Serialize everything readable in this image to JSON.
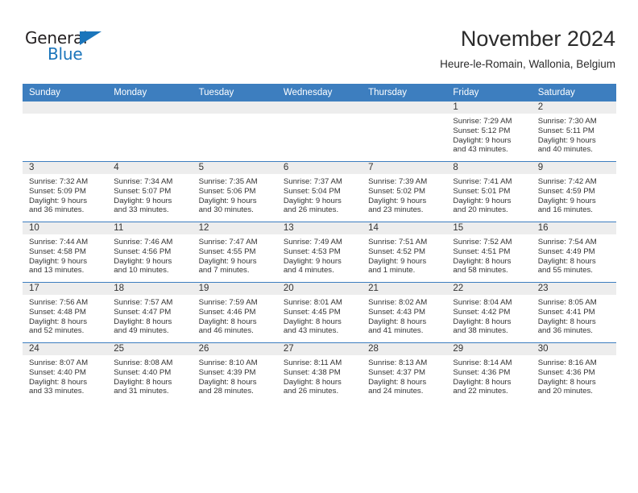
{
  "brand": {
    "name_part1": "General",
    "name_part2": "Blue",
    "accent_color": "#1b75bb",
    "logo_icon": "triangle-icon"
  },
  "header": {
    "title": "November 2024",
    "subtitle": "Heure-le-Romain, Wallonia, Belgium"
  },
  "theme": {
    "header_blue": "#3d7ebf",
    "daynum_gray": "#ededed"
  },
  "weekdays": [
    "Sunday",
    "Monday",
    "Tuesday",
    "Wednesday",
    "Thursday",
    "Friday",
    "Saturday"
  ],
  "weeks": [
    [
      {
        "day": "",
        "empty": true,
        "sunrise": "",
        "sunset": "",
        "daylight1": "",
        "daylight2": ""
      },
      {
        "day": "",
        "empty": true,
        "sunrise": "",
        "sunset": "",
        "daylight1": "",
        "daylight2": ""
      },
      {
        "day": "",
        "empty": true,
        "sunrise": "",
        "sunset": "",
        "daylight1": "",
        "daylight2": ""
      },
      {
        "day": "",
        "empty": true,
        "sunrise": "",
        "sunset": "",
        "daylight1": "",
        "daylight2": ""
      },
      {
        "day": "",
        "empty": true,
        "sunrise": "",
        "sunset": "",
        "daylight1": "",
        "daylight2": ""
      },
      {
        "day": "1",
        "sunrise": "Sunrise: 7:29 AM",
        "sunset": "Sunset: 5:12 PM",
        "daylight1": "Daylight: 9 hours",
        "daylight2": "and 43 minutes."
      },
      {
        "day": "2",
        "sunrise": "Sunrise: 7:30 AM",
        "sunset": "Sunset: 5:11 PM",
        "daylight1": "Daylight: 9 hours",
        "daylight2": "and 40 minutes."
      }
    ],
    [
      {
        "day": "3",
        "sunrise": "Sunrise: 7:32 AM",
        "sunset": "Sunset: 5:09 PM",
        "daylight1": "Daylight: 9 hours",
        "daylight2": "and 36 minutes."
      },
      {
        "day": "4",
        "sunrise": "Sunrise: 7:34 AM",
        "sunset": "Sunset: 5:07 PM",
        "daylight1": "Daylight: 9 hours",
        "daylight2": "and 33 minutes."
      },
      {
        "day": "5",
        "sunrise": "Sunrise: 7:35 AM",
        "sunset": "Sunset: 5:06 PM",
        "daylight1": "Daylight: 9 hours",
        "daylight2": "and 30 minutes."
      },
      {
        "day": "6",
        "sunrise": "Sunrise: 7:37 AM",
        "sunset": "Sunset: 5:04 PM",
        "daylight1": "Daylight: 9 hours",
        "daylight2": "and 26 minutes."
      },
      {
        "day": "7",
        "sunrise": "Sunrise: 7:39 AM",
        "sunset": "Sunset: 5:02 PM",
        "daylight1": "Daylight: 9 hours",
        "daylight2": "and 23 minutes."
      },
      {
        "day": "8",
        "sunrise": "Sunrise: 7:41 AM",
        "sunset": "Sunset: 5:01 PM",
        "daylight1": "Daylight: 9 hours",
        "daylight2": "and 20 minutes."
      },
      {
        "day": "9",
        "sunrise": "Sunrise: 7:42 AM",
        "sunset": "Sunset: 4:59 PM",
        "daylight1": "Daylight: 9 hours",
        "daylight2": "and 16 minutes."
      }
    ],
    [
      {
        "day": "10",
        "sunrise": "Sunrise: 7:44 AM",
        "sunset": "Sunset: 4:58 PM",
        "daylight1": "Daylight: 9 hours",
        "daylight2": "and 13 minutes."
      },
      {
        "day": "11",
        "sunrise": "Sunrise: 7:46 AM",
        "sunset": "Sunset: 4:56 PM",
        "daylight1": "Daylight: 9 hours",
        "daylight2": "and 10 minutes."
      },
      {
        "day": "12",
        "sunrise": "Sunrise: 7:47 AM",
        "sunset": "Sunset: 4:55 PM",
        "daylight1": "Daylight: 9 hours",
        "daylight2": "and 7 minutes."
      },
      {
        "day": "13",
        "sunrise": "Sunrise: 7:49 AM",
        "sunset": "Sunset: 4:53 PM",
        "daylight1": "Daylight: 9 hours",
        "daylight2": "and 4 minutes."
      },
      {
        "day": "14",
        "sunrise": "Sunrise: 7:51 AM",
        "sunset": "Sunset: 4:52 PM",
        "daylight1": "Daylight: 9 hours",
        "daylight2": "and 1 minute."
      },
      {
        "day": "15",
        "sunrise": "Sunrise: 7:52 AM",
        "sunset": "Sunset: 4:51 PM",
        "daylight1": "Daylight: 8 hours",
        "daylight2": "and 58 minutes."
      },
      {
        "day": "16",
        "sunrise": "Sunrise: 7:54 AM",
        "sunset": "Sunset: 4:49 PM",
        "daylight1": "Daylight: 8 hours",
        "daylight2": "and 55 minutes."
      }
    ],
    [
      {
        "day": "17",
        "sunrise": "Sunrise: 7:56 AM",
        "sunset": "Sunset: 4:48 PM",
        "daylight1": "Daylight: 8 hours",
        "daylight2": "and 52 minutes."
      },
      {
        "day": "18",
        "sunrise": "Sunrise: 7:57 AM",
        "sunset": "Sunset: 4:47 PM",
        "daylight1": "Daylight: 8 hours",
        "daylight2": "and 49 minutes."
      },
      {
        "day": "19",
        "sunrise": "Sunrise: 7:59 AM",
        "sunset": "Sunset: 4:46 PM",
        "daylight1": "Daylight: 8 hours",
        "daylight2": "and 46 minutes."
      },
      {
        "day": "20",
        "sunrise": "Sunrise: 8:01 AM",
        "sunset": "Sunset: 4:45 PM",
        "daylight1": "Daylight: 8 hours",
        "daylight2": "and 43 minutes."
      },
      {
        "day": "21",
        "sunrise": "Sunrise: 8:02 AM",
        "sunset": "Sunset: 4:43 PM",
        "daylight1": "Daylight: 8 hours",
        "daylight2": "and 41 minutes."
      },
      {
        "day": "22",
        "sunrise": "Sunrise: 8:04 AM",
        "sunset": "Sunset: 4:42 PM",
        "daylight1": "Daylight: 8 hours",
        "daylight2": "and 38 minutes."
      },
      {
        "day": "23",
        "sunrise": "Sunrise: 8:05 AM",
        "sunset": "Sunset: 4:41 PM",
        "daylight1": "Daylight: 8 hours",
        "daylight2": "and 36 minutes."
      }
    ],
    [
      {
        "day": "24",
        "sunrise": "Sunrise: 8:07 AM",
        "sunset": "Sunset: 4:40 PM",
        "daylight1": "Daylight: 8 hours",
        "daylight2": "and 33 minutes."
      },
      {
        "day": "25",
        "sunrise": "Sunrise: 8:08 AM",
        "sunset": "Sunset: 4:40 PM",
        "daylight1": "Daylight: 8 hours",
        "daylight2": "and 31 minutes."
      },
      {
        "day": "26",
        "sunrise": "Sunrise: 8:10 AM",
        "sunset": "Sunset: 4:39 PM",
        "daylight1": "Daylight: 8 hours",
        "daylight2": "and 28 minutes."
      },
      {
        "day": "27",
        "sunrise": "Sunrise: 8:11 AM",
        "sunset": "Sunset: 4:38 PM",
        "daylight1": "Daylight: 8 hours",
        "daylight2": "and 26 minutes."
      },
      {
        "day": "28",
        "sunrise": "Sunrise: 8:13 AM",
        "sunset": "Sunset: 4:37 PM",
        "daylight1": "Daylight: 8 hours",
        "daylight2": "and 24 minutes."
      },
      {
        "day": "29",
        "sunrise": "Sunrise: 8:14 AM",
        "sunset": "Sunset: 4:36 PM",
        "daylight1": "Daylight: 8 hours",
        "daylight2": "and 22 minutes."
      },
      {
        "day": "30",
        "sunrise": "Sunrise: 8:16 AM",
        "sunset": "Sunset: 4:36 PM",
        "daylight1": "Daylight: 8 hours",
        "daylight2": "and 20 minutes."
      }
    ]
  ]
}
